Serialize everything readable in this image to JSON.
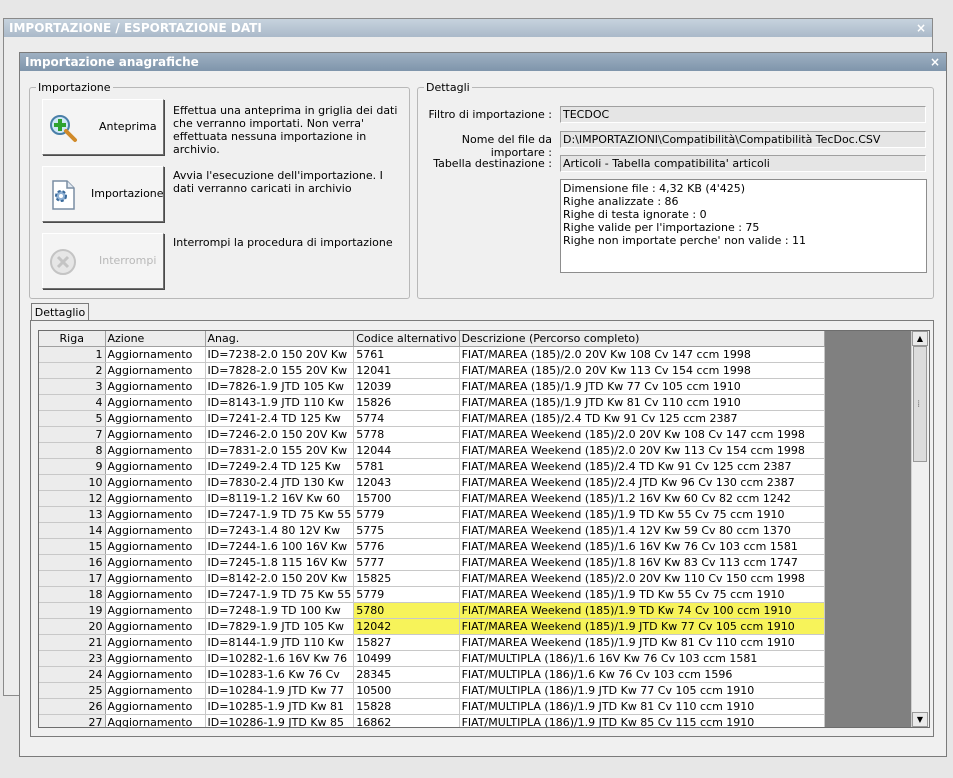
{
  "outer_window": {
    "title": "IMPORTAZIONE / ESPORTAZIONE DATI",
    "close": "×"
  },
  "dialog": {
    "title": "Importazione anagrafiche",
    "close": "×"
  },
  "importazione": {
    "legend": "Importazione",
    "preview_button": "Anteprima",
    "preview_desc": "Effettua una anteprima in griglia dei dati che verranno importati. Non verra' effettuata nessuna importazione in archivio.",
    "import_button": "Importazione",
    "import_desc": "Avvia l'esecuzione dell'importazione. I dati verranno caricati in archivio",
    "stop_button": "Interrompi",
    "stop_desc": "Interrompi la procedura di importazione"
  },
  "dettagli": {
    "legend": "Dettagli",
    "filter_label": "Filtro di importazione :",
    "filter_value": "TECDOC",
    "file_label": "Nome del file da importare :",
    "file_value": "D:\\IMPORTAZIONI\\Compatibilità\\Compatibilità TecDoc.CSV",
    "table_label": "Tabella destinazione :",
    "table_value": "Articoli - Tabella compatibilita' articoli",
    "stats": [
      "Dimensione file : 4,32 KB (4'425)",
      "Righe analizzate : 86",
      "Righe di testa ignorate : 0",
      "Righe valide per l'importazione : 75",
      "Righe non importate perche' non valide : 11"
    ]
  },
  "tab_label": "Dettaglio",
  "grid": {
    "columns": [
      "Riga",
      "Azione",
      "Anag.",
      "Codice alternativo",
      "Descrizione (Percorso completo)"
    ],
    "rows": [
      [
        "1",
        "Aggiornamento",
        "ID=7238-2.0 150 20V Kw",
        "5761",
        "FIAT/MAREA (185)/2.0 20V Kw 108 Cv 147 ccm 1998"
      ],
      [
        "2",
        "Aggiornamento",
        "ID=7828-2.0 155 20V Kw",
        "12041",
        "FIAT/MAREA (185)/2.0 20V Kw 113 Cv 154 ccm 1998"
      ],
      [
        "3",
        "Aggiornamento",
        "ID=7826-1.9 JTD 105 Kw",
        "12039",
        "FIAT/MAREA (185)/1.9 JTD Kw 77 Cv 105 ccm 1910"
      ],
      [
        "4",
        "Aggiornamento",
        "ID=8143-1.9 JTD 110 Kw",
        "15826",
        "FIAT/MAREA (185)/1.9 JTD Kw 81 Cv 110 ccm 1910"
      ],
      [
        "5",
        "Aggiornamento",
        "ID=7241-2.4 TD 125 Kw",
        "5774",
        "FIAT/MAREA (185)/2.4 TD Kw 91 Cv 125 ccm 2387"
      ],
      [
        "7",
        "Aggiornamento",
        "ID=7246-2.0 150 20V Kw",
        "5778",
        "FIAT/MAREA Weekend (185)/2.0 20V Kw 108 Cv 147 ccm 1998"
      ],
      [
        "8",
        "Aggiornamento",
        "ID=7831-2.0 155 20V Kw",
        "12044",
        "FIAT/MAREA Weekend (185)/2.0 20V Kw 113 Cv 154 ccm 1998"
      ],
      [
        "9",
        "Aggiornamento",
        "ID=7249-2.4 TD 125 Kw",
        "5781",
        "FIAT/MAREA Weekend (185)/2.4 TD Kw 91 Cv 125 ccm 2387"
      ],
      [
        "10",
        "Aggiornamento",
        "ID=7830-2.4 JTD 130 Kw",
        "12043",
        "FIAT/MAREA Weekend (185)/2.4 JTD Kw 96 Cv 130 ccm 2387"
      ],
      [
        "12",
        "Aggiornamento",
        "ID=8119-1.2 16V Kw 60",
        "15700",
        "FIAT/MAREA Weekend (185)/1.2 16V Kw 60 Cv 82 ccm 1242"
      ],
      [
        "13",
        "Aggiornamento",
        "ID=7247-1.9 TD 75 Kw 55",
        "5779",
        "FIAT/MAREA Weekend (185)/1.9 TD Kw 55 Cv 75 ccm 1910"
      ],
      [
        "14",
        "Aggiornamento",
        "ID=7243-1.4 80 12V Kw",
        "5775",
        "FIAT/MAREA Weekend (185)/1.4 12V Kw 59 Cv 80 ccm 1370"
      ],
      [
        "15",
        "Aggiornamento",
        "ID=7244-1.6 100 16V Kw",
        "5776",
        "FIAT/MAREA Weekend (185)/1.6 16V Kw 76 Cv 103 ccm 1581"
      ],
      [
        "16",
        "Aggiornamento",
        "ID=7245-1.8 115 16V Kw",
        "5777",
        "FIAT/MAREA Weekend (185)/1.8 16V Kw 83 Cv 113 ccm 1747"
      ],
      [
        "17",
        "Aggiornamento",
        "ID=8142-2.0 150 20V Kw",
        "15825",
        "FIAT/MAREA Weekend (185)/2.0 20V Kw 110 Cv 150 ccm 1998"
      ],
      [
        "18",
        "Aggiornamento",
        "ID=7247-1.9 TD 75 Kw 55",
        "5779",
        "FIAT/MAREA Weekend (185)/1.9 TD Kw 55 Cv 75 ccm 1910"
      ],
      [
        "19",
        "Aggiornamento",
        "ID=7248-1.9 TD 100 Kw",
        "5780",
        "FIAT/MAREA Weekend (185)/1.9 TD Kw 74 Cv 100 ccm 1910"
      ],
      [
        "20",
        "Aggiornamento",
        "ID=7829-1.9 JTD 105 Kw",
        "12042",
        "FIAT/MAREA Weekend (185)/1.9 JTD Kw 77 Cv 105 ccm 1910"
      ],
      [
        "21",
        "Aggiornamento",
        "ID=8144-1.9 JTD 110 Kw",
        "15827",
        "FIAT/MAREA Weekend (185)/1.9 JTD Kw 81 Cv 110 ccm 1910"
      ],
      [
        "23",
        "Aggiornamento",
        "ID=10282-1.6 16V  Kw 76",
        "10499",
        "FIAT/MULTIPLA (186)/1.6 16V  Kw 76 Cv 103 ccm 1581"
      ],
      [
        "24",
        "Aggiornamento",
        "ID=10283-1.6 Kw 76 Cv",
        "28345",
        "FIAT/MULTIPLA (186)/1.6 Kw 76 Cv 103 ccm 1596"
      ],
      [
        "25",
        "Aggiornamento",
        "ID=10284-1.9 JTD Kw 77",
        "10500",
        "FIAT/MULTIPLA (186)/1.9 JTD Kw 77 Cv 105 ccm 1910"
      ],
      [
        "26",
        "Aggiornamento",
        "ID=10285-1.9 JTD Kw 81",
        "15828",
        "FIAT/MULTIPLA (186)/1.9 JTD Kw 81 Cv 110 ccm 1910"
      ],
      [
        "27",
        "Aggiornamento",
        "ID=10286-1.9 JTD Kw 85",
        "16862",
        "FIAT/MULTIPLA (186)/1.9 JTD Kw 85 Cv 115 ccm 1910"
      ]
    ],
    "highlighted_rows": [
      "19",
      "20"
    ],
    "highlight_color": "#f7f35a"
  },
  "scrollbar": {
    "up": "▲",
    "down": "▼",
    "grip": "⁞"
  }
}
